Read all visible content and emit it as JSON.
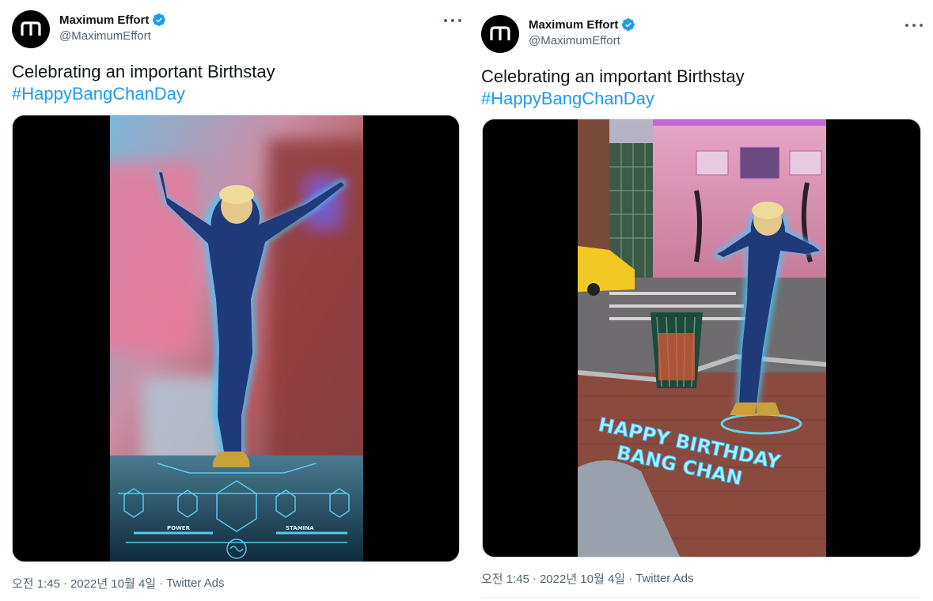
{
  "tweets": [
    {
      "author": {
        "name": "Maximum Effort",
        "handle": "@MaximumEffort",
        "avatar_glyph": "m"
      },
      "text": "Celebrating an important Birthstay",
      "hashtag": "#HappyBangChanDay",
      "video_overlay": {
        "left_label": "POWER",
        "right_label": "STAMINA"
      },
      "meta": {
        "time": "오전 1:45",
        "date": "2022년 10월 4일",
        "source": "Twitter Ads",
        "sep": "·"
      }
    },
    {
      "author": {
        "name": "Maximum Effort",
        "handle": "@MaximumEffort",
        "avatar_glyph": "m"
      },
      "text": "Celebrating an important Birthstay",
      "hashtag": "#HappyBangChanDay",
      "video_overlay": {
        "line1": "HAPPY BIRTHDAY",
        "line2": "BANG CHAN"
      },
      "meta": {
        "time": "오전 1:45",
        "date": "2022년 10월 4일",
        "source": "Twitter Ads",
        "sep": "·"
      }
    }
  ],
  "colors": {
    "link": "#1d9bf0",
    "verified": "#1d9bf0",
    "secondary": "#536471",
    "glow": "#38c8ff"
  }
}
